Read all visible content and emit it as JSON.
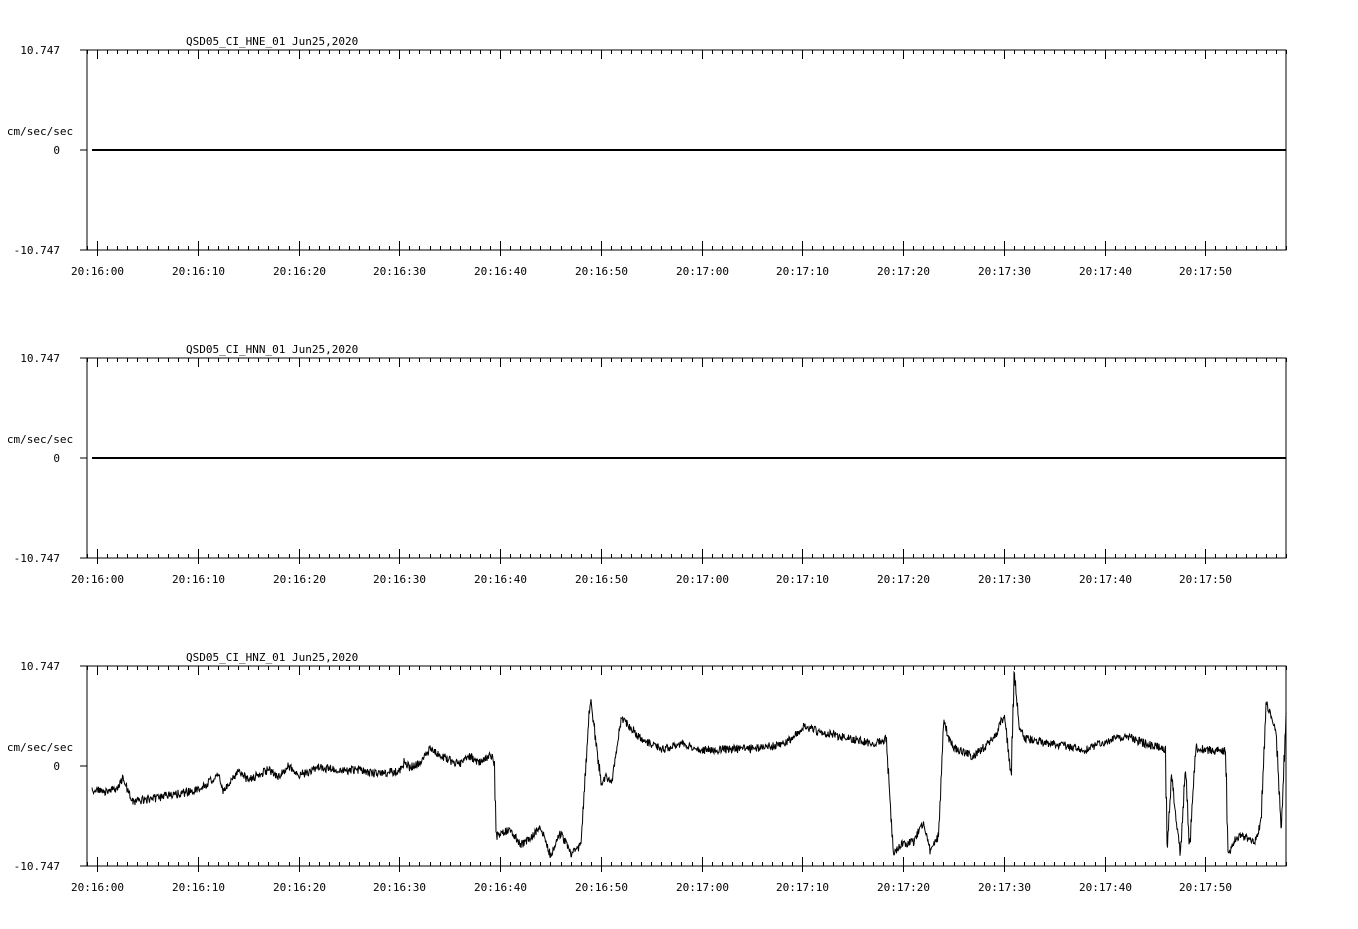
{
  "chart_data": [
    {
      "type": "line",
      "title": "QSD05_CI_HNE_01  Jun25,2020",
      "ylabel": "cm/sec/sec",
      "ylim": [
        -10.747,
        10.747
      ],
      "yticks": [
        "10.747",
        "0",
        "-10.747"
      ],
      "xlim": [
        "20:15:59",
        "20:17:58"
      ],
      "xticks": [
        "20:16:00",
        "20:16:10",
        "20:16:20",
        "20:16:30",
        "20:16:40",
        "20:16:50",
        "20:17:00",
        "20:17:10",
        "20:17:20",
        "20:17:30",
        "20:17:40",
        "20:17:50"
      ],
      "grid": false,
      "series": [
        {
          "x": [
            "20:15:59.5",
            "20:17:58"
          ],
          "y": [
            0.0,
            0.0
          ]
        }
      ]
    },
    {
      "type": "line",
      "title": "QSD05_CI_HNN_01  Jun25,2020",
      "ylabel": "cm/sec/sec",
      "ylim": [
        -10.747,
        10.747
      ],
      "yticks": [
        "10.747",
        "0",
        "-10.747"
      ],
      "xlim": [
        "20:15:59",
        "20:17:58"
      ],
      "xticks": [
        "20:16:00",
        "20:16:10",
        "20:16:20",
        "20:16:30",
        "20:16:40",
        "20:16:50",
        "20:17:00",
        "20:17:10",
        "20:17:20",
        "20:17:30",
        "20:17:40",
        "20:17:50"
      ],
      "grid": false,
      "series": [
        {
          "x": [
            "20:15:59.5",
            "20:17:58"
          ],
          "y": [
            0.0,
            0.0
          ]
        }
      ]
    },
    {
      "type": "line",
      "title": "QSD05_CI_HNZ_01  Jun25,2020",
      "ylabel": "cm/sec/sec",
      "ylim": [
        -10.747,
        10.747
      ],
      "yticks": [
        "10.747",
        "0",
        "-10.747"
      ],
      "xlim": [
        "20:15:59",
        "20:17:58"
      ],
      "xticks": [
        "20:16:00",
        "20:16:10",
        "20:16:20",
        "20:16:30",
        "20:16:40",
        "20:16:50",
        "20:17:00",
        "20:17:10",
        "20:17:20",
        "20:17:30",
        "20:17:40",
        "20:17:50"
      ],
      "grid": false,
      "series": [
        {
          "x": [
            "20:15:59.5",
            "20:16:01",
            "20:16:02",
            "20:16:02.5",
            "20:16:03",
            "20:16:03.5",
            "20:16:05",
            "20:16:10",
            "20:16:12",
            "20:16:12.5",
            "20:16:14",
            "20:16:15",
            "20:16:17",
            "20:16:18",
            "20:16:19",
            "20:16:20",
            "20:16:21",
            "20:16:22",
            "20:16:24",
            "20:16:26",
            "20:16:27",
            "20:16:30",
            "20:16:30.5",
            "20:16:31",
            "20:16:32",
            "20:16:33",
            "20:16:35",
            "20:16:36",
            "20:16:37",
            "20:16:38",
            "20:16:39",
            "20:16:39.4",
            "20:16:39.6",
            "20:16:40",
            "20:16:41",
            "20:16:42",
            "20:16:43",
            "20:16:44",
            "20:16:45",
            "20:16:46",
            "20:16:47",
            "20:16:48",
            "20:16:48.3",
            "20:16:48.8",
            "20:16:49",
            "20:16:49.5",
            "20:16:50",
            "20:16:50.5",
            "20:16:51",
            "20:16:52",
            "20:16:54",
            "20:16:56",
            "20:16:58",
            "20:17:00",
            "20:17:05",
            "20:17:08",
            "20:17:09",
            "20:17:10",
            "20:17:12",
            "20:17:15",
            "20:17:17",
            "20:17:18",
            "20:17:18.3",
            "20:17:19",
            "20:17:20",
            "20:17:21",
            "20:17:22",
            "20:17:22.7",
            "20:17:23.5",
            "20:17:24",
            "20:17:24.5",
            "20:17:25",
            "20:17:27",
            "20:17:28",
            "20:17:29",
            "20:17:30",
            "20:17:30.7",
            "20:17:31",
            "20:17:31.5",
            "20:17:32",
            "20:17:34",
            "20:17:36",
            "20:17:38",
            "20:17:40",
            "20:17:42",
            "20:17:44",
            "20:17:46",
            "20:17:46.2",
            "20:17:46.6",
            "20:17:47",
            "20:17:47.5",
            "20:17:48",
            "20:17:48.4",
            "20:17:49",
            "20:17:50",
            "20:17:52",
            "20:17:52.2",
            "20:17:52.8",
            "20:17:53",
            "20:17:55",
            "20:17:55.5",
            "20:17:56",
            "20:17:57",
            "20:17:57.5",
            "20:17:58"
          ],
          "y": [
            -2.6,
            -2.8,
            -2.5,
            -1.3,
            -2.5,
            -3.8,
            -3.6,
            -2.6,
            -1.0,
            -2.8,
            -0.6,
            -1.5,
            -0.4,
            -1.2,
            0.0,
            -0.9,
            -0.7,
            -0.1,
            -0.5,
            -0.4,
            -0.8,
            -0.6,
            0.6,
            -0.2,
            0.3,
            1.8,
            0.6,
            0.2,
            1.0,
            0.3,
            1.2,
            0.4,
            -7.6,
            -7.2,
            -6.8,
            -8.5,
            -7.8,
            -6.5,
            -9.6,
            -7.1,
            -9.5,
            -8.5,
            -3.0,
            5.5,
            7.0,
            2.5,
            -1.8,
            -1.0,
            -2.0,
            5.2,
            2.9,
            1.8,
            2.4,
            1.7,
            1.9,
            2.3,
            3.0,
            4.2,
            3.6,
            2.9,
            2.4,
            2.7,
            3.0,
            -9.3,
            -8.3,
            -8.2,
            -6.0,
            -9.3,
            -7.5,
            5.0,
            3.0,
            2.0,
            1.0,
            2.0,
            3.0,
            5.5,
            -1.0,
            10.0,
            4.0,
            3.0,
            2.5,
            2.2,
            1.7,
            2.6,
            3.3,
            2.4,
            1.8,
            -9.0,
            -1.0,
            -5.0,
            -9.5,
            0.0,
            -9.2,
            2.0,
            1.7,
            1.7,
            -9.6,
            -8.5,
            -7.5,
            -8.0,
            -6.0,
            7.0,
            3.5,
            -7.0,
            6.0
          ]
        }
      ]
    }
  ]
}
